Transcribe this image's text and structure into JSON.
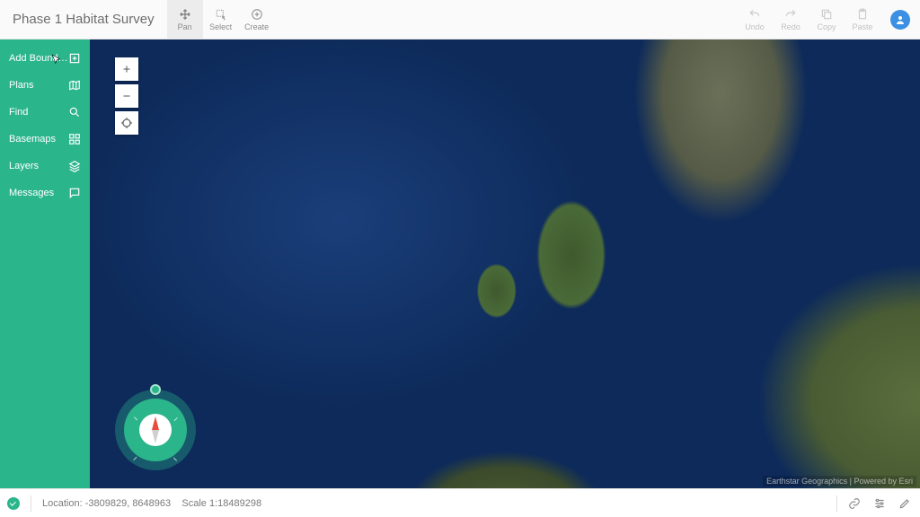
{
  "colors": {
    "accent": "#2bb58b",
    "avatar": "#3b90e3"
  },
  "header": {
    "title": "Phase 1 Habitat Survey",
    "tools": {
      "pan": "Pan",
      "select": "Select",
      "create": "Create",
      "undo": "Undo",
      "redo": "Redo",
      "copy": "Copy",
      "paste": "Paste"
    }
  },
  "sidebar": {
    "items": [
      {
        "label": "Add Bounda...",
        "icon": "polygon-add-icon"
      },
      {
        "label": "Plans",
        "icon": "map-icon"
      },
      {
        "label": "Find",
        "icon": "search-icon"
      },
      {
        "label": "Basemaps",
        "icon": "grid-icon"
      },
      {
        "label": "Layers",
        "icon": "layers-icon"
      },
      {
        "label": "Messages",
        "icon": "chat-icon"
      }
    ]
  },
  "map": {
    "attribution": "Earthstar Geographics | Powered by Esri"
  },
  "status": {
    "location_label": "Location:",
    "location_value": "-3809829, 8648963",
    "scale_label": "Scale",
    "scale_value": "1:18489298"
  }
}
